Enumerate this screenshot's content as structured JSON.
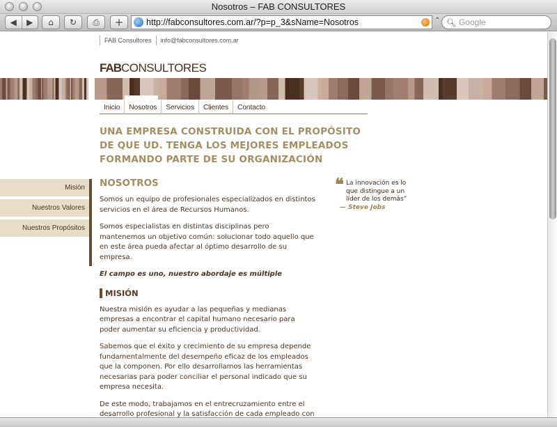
{
  "window": {
    "title": "Nosotros – FAB CONSULTORES"
  },
  "toolbar": {
    "back_glyph": "◀",
    "forward_glyph": "▶",
    "home_glyph": "⌂",
    "reload_glyph": "↻",
    "print_glyph": "⎙",
    "add_glyph": "+",
    "url": "http://fabconsultores.com.ar/?p=p_3&sName=Nosotros",
    "search_placeholder": "Google"
  },
  "site": {
    "top_links": [
      "FAB Consultores",
      "info@fabconsultores.com.ar"
    ],
    "logo_bold": "FAB",
    "logo_rest": "CONSULTORES",
    "nav": [
      "Inicio",
      "Nosotros",
      "Servicios",
      "Clientes",
      "Contacto"
    ],
    "active_nav": "Nosotros",
    "headline": "UNA EMPRESA CONSTRUIDA CON EL PROPÓSITO DE QUE UD. TENGA LOS MEJORES EMPLEADOS FORMANDO PARTE DE SU ORGANIZACIÓN",
    "banner_colors": [
      "#4a2e20",
      "#6b4a3a",
      "#8a6656",
      "#a07c6a",
      "#b4978a",
      "#c8b0a3",
      "#9a7464",
      "#5a3a2c",
      "#c0a597",
      "#d2bdb1",
      "#8c6a5b",
      "#b8988a",
      "#caa99b",
      "#a17e70",
      "#d8c4ba",
      "#7c5848"
    ]
  },
  "sidebar": {
    "items": [
      "Misión",
      "Nuestros Valores",
      "Nuestros Propósitos"
    ]
  },
  "content": {
    "title": "NOSOTROS",
    "p1": "Somos un equipo de profesionales especializados en distintos servicios en el área de Recursos Humanos.",
    "p2": "Somos especialistas en distintas disciplinas pero mantenemos un objetivo común: solucionar todo aquello que en este área pueda afectar al óptimo desarrollo de su empresa.",
    "tagline": "El campo es uno, nuestro abordaje es múltiple",
    "mision_title": "MISIÓN",
    "m1": "Nuestra misión es ayudar a las pequeñas y medianas empresas a encontrar el capital humano necesario para poder aumentar su eficiencia y productividad.",
    "m2": "Sabemos que el éxito y crecimiento de su empresa depende fundamentalmente del desempeño eficaz de los empleados que la componen. Por ello desarrollamos las herramientas necesarias para poder conciliar el personal indicado que su empresa necesita.",
    "m3": "De este modo, trabajamos en el entrecruzamiento entre el desarrollo profesional y la satisfacción de cada empleado con las necesidades y el crecimiento de su empresa."
  },
  "quote": {
    "mark": "❝",
    "text": "La innovación es lo que distingue a un líder de los demás”",
    "author": "— Steve Jobs"
  }
}
